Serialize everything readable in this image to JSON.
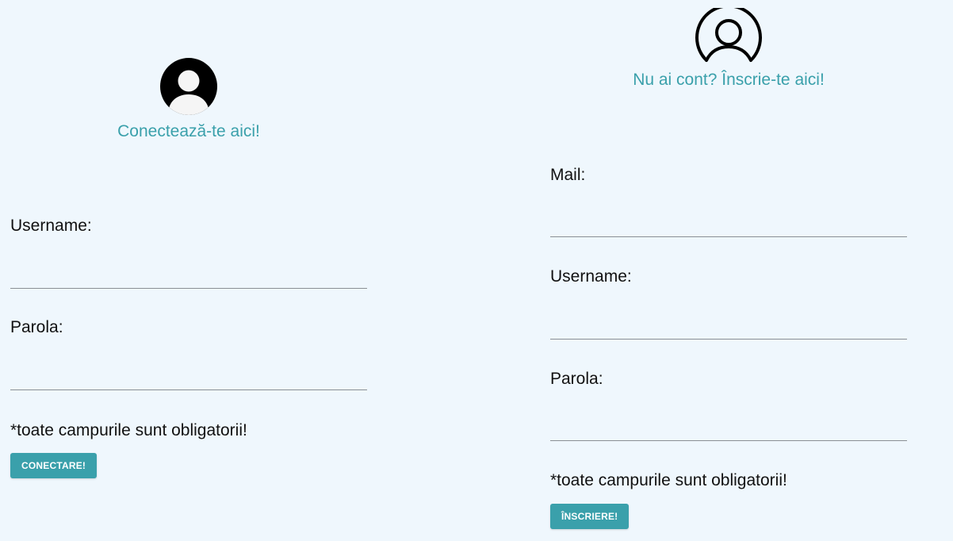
{
  "login": {
    "heading": "Conectează-te aici!",
    "avatar_icon": "filled-user-avatar-icon",
    "username_label": "Username:",
    "username_value": "",
    "password_label": "Parola:",
    "password_value": "",
    "note": "*toate campurile sunt obligatorii!",
    "button_label": "CONECTARE!"
  },
  "signup": {
    "heading": "Nu ai cont? Înscrie-te aici!",
    "avatar_icon": "outline-user-avatar-icon",
    "mail_label": "Mail:",
    "mail_value": "",
    "username_label": "Username:",
    "username_value": "",
    "password_label": "Parola:",
    "password_value": "",
    "note": "*toate campurile sunt obligatorii!",
    "button_label": "ÎNSCRIERE!"
  },
  "colors": {
    "background": "#eff7fd",
    "accent": "#3aa0ab",
    "text": "#111111",
    "input_underline": "#8a8f94"
  }
}
